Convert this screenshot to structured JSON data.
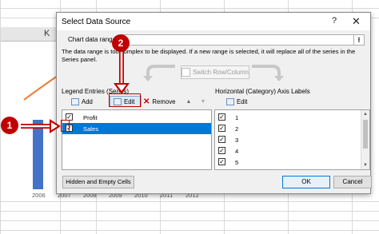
{
  "background": {
    "column_letter": "K",
    "years": [
      "2006",
      "2007",
      "2008",
      "2009",
      "2010",
      "2011",
      "2012"
    ]
  },
  "dialog": {
    "title": "Select Data Source",
    "help_label": "?",
    "close_label": "✕",
    "chart_data_range_label": "Chart data range:",
    "chart_data_range_value": "",
    "info_text": "The data range is too complex to be displayed. If a new range is selected, it will replace all of the series in the Series panel.",
    "switch_label": "Switch Row/Column",
    "legend_title": "Legend Entries (Series)",
    "axis_title": "Horizontal (Category) Axis Labels",
    "legend_toolbar": {
      "add": "Add",
      "edit": "Edit",
      "remove": "Remove",
      "up": "▲",
      "down": "▼"
    },
    "axis_toolbar": {
      "edit": "Edit"
    },
    "series": [
      {
        "label": "Profit",
        "checked": true,
        "selected": false
      },
      {
        "label": "Sales",
        "checked": true,
        "selected": true
      }
    ],
    "axis_labels": [
      "1",
      "2",
      "3",
      "4",
      "5"
    ],
    "hidden_cells_label": "Hidden and Empty Cells",
    "ok_label": "OK",
    "cancel_label": "Cancel"
  },
  "annotations": {
    "marker_1": "1",
    "marker_2": "2"
  },
  "colors": {
    "accent": "#0078d7",
    "annotation": "#c00000",
    "bar": "#4472c4",
    "line": "#ed7d31"
  }
}
